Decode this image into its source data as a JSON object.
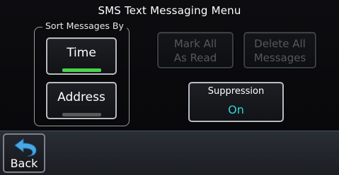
{
  "title": "SMS Text Messaging Menu",
  "sort_group": {
    "label": "Sort Messages By",
    "time": {
      "label": "Time",
      "selected": true,
      "indicator_color": "#4cd14c"
    },
    "address": {
      "label": "Address",
      "selected": false,
      "indicator_color": "#5a5a5a"
    }
  },
  "actions": {
    "mark_all_line1": "Mark All",
    "mark_all_line2": "As Read",
    "delete_all_line1": "Delete All",
    "delete_all_line2": "Messages"
  },
  "suppression": {
    "label": "Suppression",
    "value": "On",
    "value_color": "#2fd3d3"
  },
  "bottom": {
    "back_label": "Back",
    "back_icon": "back-arrow-icon",
    "back_icon_color": "#49a7e6"
  }
}
